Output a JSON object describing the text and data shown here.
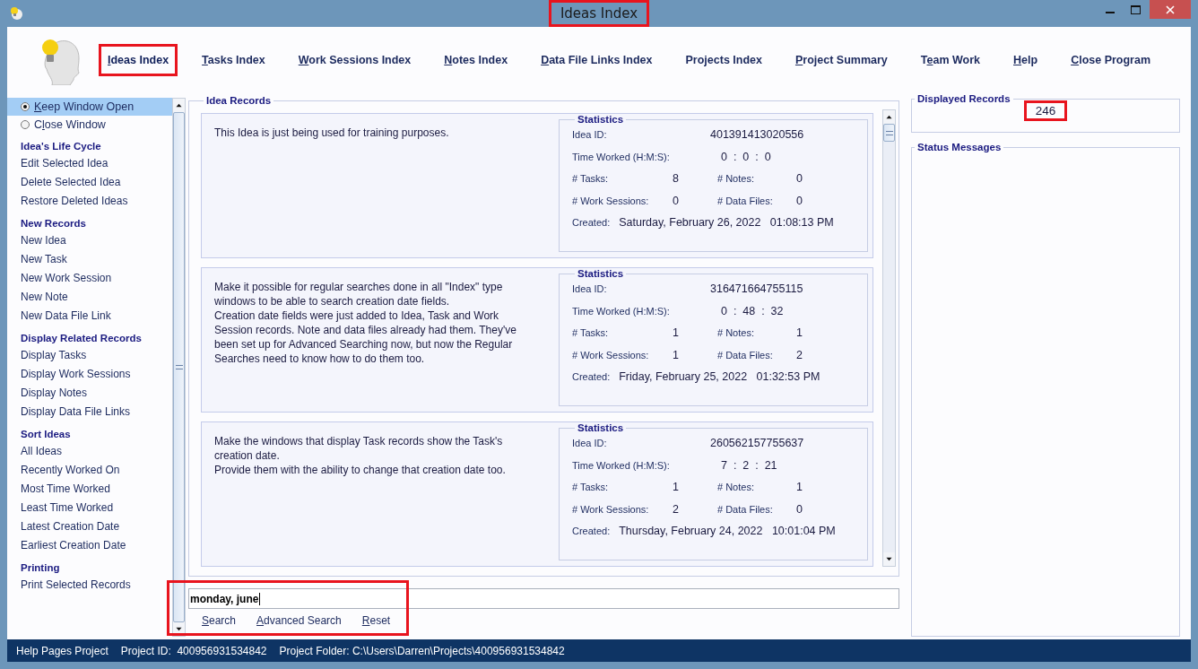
{
  "window": {
    "title": "Ideas Index",
    "highlighted": true
  },
  "nav": [
    {
      "key": "I",
      "post": "deas Index",
      "selected": true,
      "highlighted": true
    },
    {
      "key": "T",
      "post": "asks Index",
      "selected": false,
      "highlighted": false
    },
    {
      "key": "W",
      "post": "ork Sessions Index",
      "selected": false,
      "highlighted": false
    },
    {
      "key": "N",
      "post": "otes Index",
      "selected": false,
      "highlighted": false
    },
    {
      "key": "D",
      "post": "ata File Links Index",
      "selected": false,
      "highlighted": false
    },
    {
      "pre": "Projects Index",
      "selected": false,
      "highlighted": false
    },
    {
      "key": "P",
      "post": "roject Summary",
      "selected": false,
      "highlighted": false
    },
    {
      "pre": "T",
      "key": "e",
      "post": "am Work",
      "selected": false,
      "highlighted": false
    },
    {
      "key": "H",
      "post": "elp",
      "selected": false,
      "highlighted": false
    },
    {
      "key": "C",
      "post": "lose Program",
      "selected": false,
      "highlighted": false
    }
  ],
  "sidebar": {
    "options": [
      {
        "key": "K",
        "post": "eep Window Open",
        "selected": true
      },
      {
        "pre": "C",
        "key": "l",
        "post": "ose Window",
        "selected": false
      }
    ],
    "sections": [
      {
        "heading": "Idea's Life Cycle",
        "items": [
          "Edit Selected Idea",
          "Delete Selected Idea",
          "Restore Deleted Ideas"
        ]
      },
      {
        "heading": "New Records",
        "items": [
          "New Idea",
          "New Task",
          "New Work Session",
          "New Note",
          "New Data File Link"
        ]
      },
      {
        "heading": "Display Related Records",
        "items": [
          "Display Tasks",
          "Display Work Sessions",
          "Display Notes",
          "Display Data File Links"
        ]
      },
      {
        "heading": "Sort Ideas",
        "items": [
          "All Ideas",
          "Recently Worked On",
          "Most Time Worked",
          "Least Time Worked",
          "Latest Creation Date",
          "Earliest Creation Date"
        ]
      },
      {
        "heading": "Printing",
        "items": [
          "Print Selected Records"
        ]
      }
    ]
  },
  "records": {
    "title": "Idea Records",
    "items": [
      {
        "paragraphs": [
          "This Idea is just being used for training purposes."
        ],
        "stats_title": "Statistics",
        "labels": {
          "id": "Idea ID:",
          "time": "Time Worked (H:M:S):",
          "tasks": "# Tasks:",
          "notes": "# Notes:",
          "sessions": "# Work Sessions:",
          "files": "# Data Files:",
          "created": "Created:"
        },
        "id": "401391413020556",
        "time": "0  :  0  :  0",
        "tasks": "8",
        "notes": "0",
        "sessions": "0",
        "files": "0",
        "created": "Saturday, February 26, 2022   01:08:13 PM"
      },
      {
        "paragraphs": [
          "Make it possible for regular searches done in all \"Index\" type windows to be able to search creation date fields.",
          "Creation date fields were just added to Idea, Task and Work Session records. Note and data files already had them. They've been set up for Advanced Searching now, but now the Regular Searches need to know how to do them too."
        ],
        "stats_title": "Statistics",
        "labels": {
          "id": "Idea ID:",
          "time": "Time Worked (H:M:S):",
          "tasks": "# Tasks:",
          "notes": "# Notes:",
          "sessions": "# Work Sessions:",
          "files": "# Data Files:",
          "created": "Created:"
        },
        "id": "316471664755115",
        "time": "0  :  48  :  32",
        "tasks": "1",
        "notes": "1",
        "sessions": "1",
        "files": "2",
        "created": "Friday, February 25, 2022   01:32:53 PM"
      },
      {
        "paragraphs": [
          "Make the windows that display Task records show the Task's creation date.",
          "Provide them with the ability to change that creation date too."
        ],
        "stats_title": "Statistics",
        "labels": {
          "id": "Idea ID:",
          "time": "Time Worked (H:M:S):",
          "tasks": "# Tasks:",
          "notes": "# Notes:",
          "sessions": "# Work Sessions:",
          "files": "# Data Files:",
          "created": "Created:"
        },
        "id": "260562157755637",
        "time": "7  :  2  :  21",
        "tasks": "1",
        "notes": "1",
        "sessions": "2",
        "files": "0",
        "created": "Thursday, February 24, 2022   10:01:04 PM"
      }
    ]
  },
  "search": {
    "value": "monday, june",
    "highlighted": true,
    "buttons": [
      {
        "key": "S",
        "post": "earch"
      },
      {
        "key": "A",
        "post": "dvanced Search"
      },
      {
        "key": "R",
        "post": "eset"
      }
    ]
  },
  "displayed_records": {
    "title": "Displayed Records",
    "count": "246",
    "highlighted": true
  },
  "status_messages": {
    "title": "Status Messages"
  },
  "status_bar": [
    "Help Pages Project",
    "Project ID:  400956931534842",
    "Project Folder: C:\\Users\\Darren\\Projects\\400956931534842"
  ]
}
